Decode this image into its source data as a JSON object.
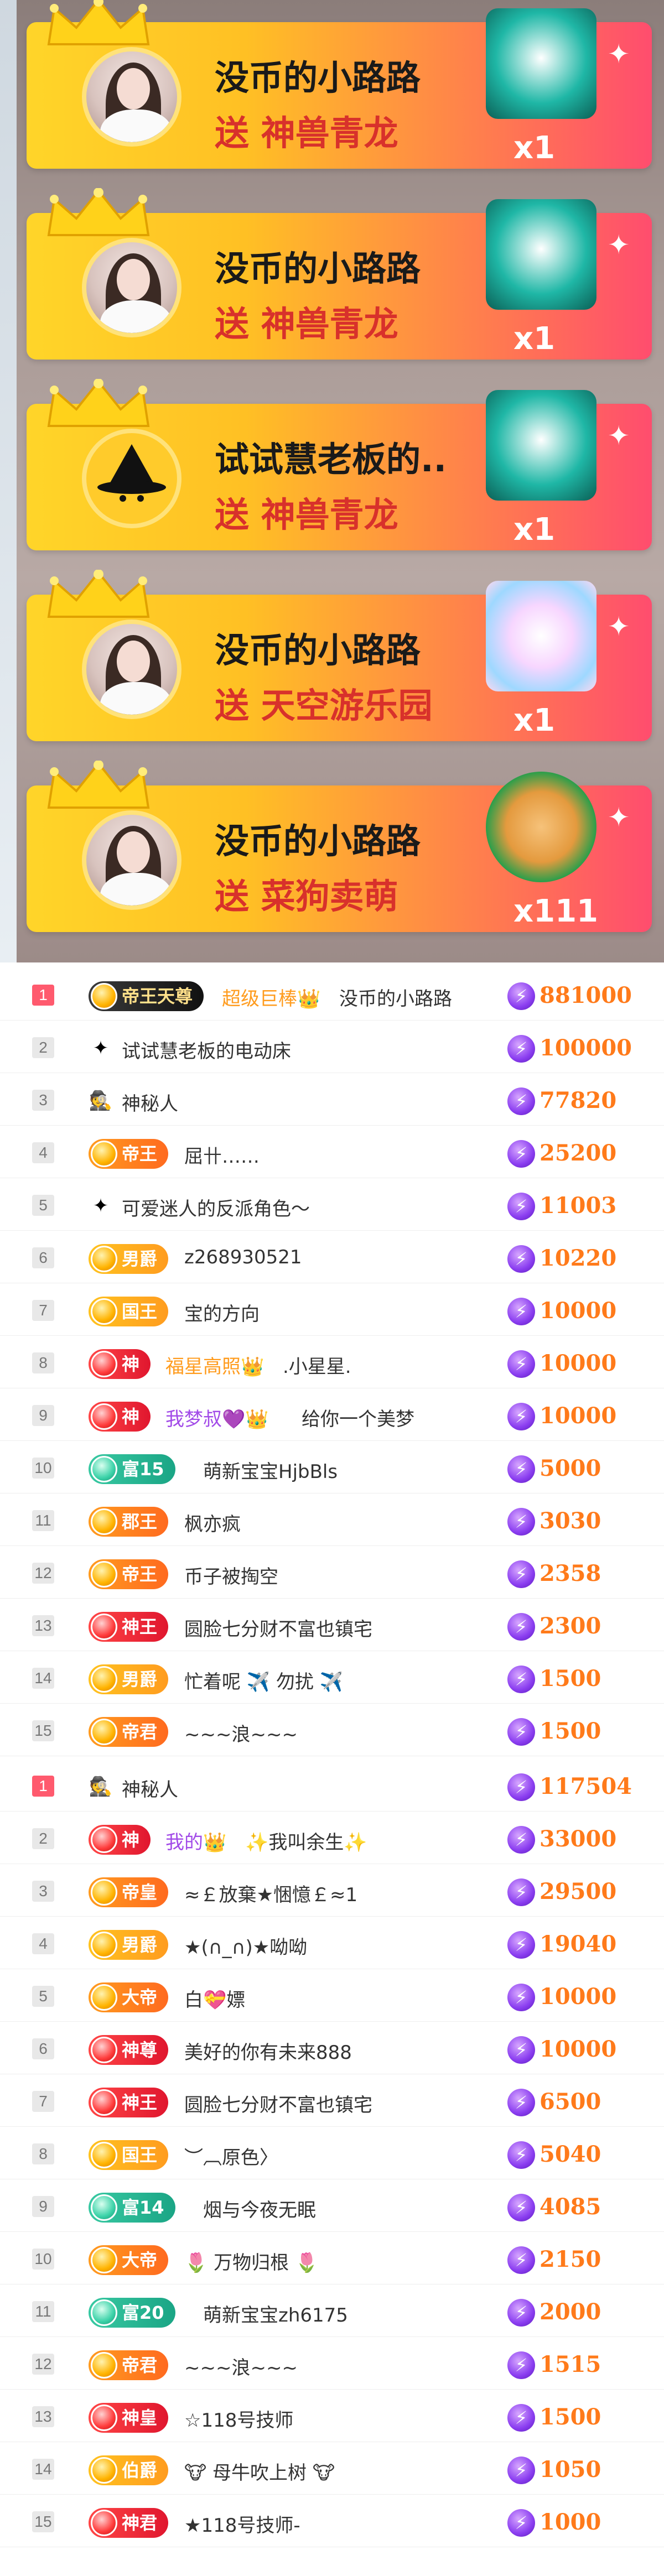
{
  "gift_banners": [
    {
      "name": "没币的小路路",
      "gift_text": "送 神兽青龙",
      "count": "x1",
      "avatar": "girl",
      "gift_icon": "dragon-icon",
      "gift_color": "#1fb7a6"
    },
    {
      "name": "没币的小路路",
      "gift_text": "送 神兽青龙",
      "count": "x1",
      "avatar": "girl",
      "gift_icon": "dragon-icon",
      "gift_color": "#1fb7a6"
    },
    {
      "name": "试试慧老板的..",
      "gift_text": "送 神兽青龙",
      "count": "x1",
      "avatar": "witch",
      "gift_icon": "dragon-icon",
      "gift_color": "#1fb7a6"
    },
    {
      "name": "没币的小路路",
      "gift_text": "送 天空游乐园",
      "count": "x1",
      "avatar": "girl",
      "gift_icon": "castle-icon",
      "gift_color": "#b9e3ff"
    },
    {
      "name": "没币的小路路",
      "gift_text": "送 菜狗卖萌",
      "count": "x111",
      "avatar": "girl",
      "gift_icon": "dog-icon",
      "gift_color": "#2e9e4a"
    }
  ],
  "ranking_1": [
    {
      "rank": "1",
      "badge": "帝王天尊",
      "badge_style": "dark",
      "prefix": "超级巨棒👑",
      "name": "没币的小路路",
      "name_style": "gold",
      "score": "881000"
    },
    {
      "rank": "2",
      "badge": "",
      "icon": "✦",
      "name": "试试慧老板的电动床",
      "score": "100000"
    },
    {
      "rank": "3",
      "badge": "",
      "icon": "🕵",
      "name": "神秘人",
      "score": "77820"
    },
    {
      "rank": "4",
      "badge": "帝王",
      "badge_style": "orange",
      "name": "屈卄……",
      "score": "25200"
    },
    {
      "rank": "5",
      "badge": "",
      "icon": "✦",
      "name": "可爱迷人的反派角色～",
      "score": "11003"
    },
    {
      "rank": "6",
      "badge": "男爵",
      "badge_style": "gold",
      "name": "z268930521",
      "score": "10220"
    },
    {
      "rank": "7",
      "badge": "国王",
      "badge_style": "gold",
      "name": "宝的方向",
      "score": "10000"
    },
    {
      "rank": "8",
      "badge": "神",
      "badge_style": "red",
      "prefix": "福星高照👑",
      "name": ".小星星.",
      "name_style": "gold",
      "score": "10000"
    },
    {
      "rank": "9",
      "badge": "神",
      "badge_style": "red",
      "prefix": "我梦叔💜👑",
      "name": "给你一个美梦",
      "name_style": "purple",
      "score": "10000"
    },
    {
      "rank": "10",
      "badge": "富15",
      "badge_style": "green",
      "name": "萌新宝宝HjbBls",
      "score": "5000"
    },
    {
      "rank": "11",
      "badge": "郡王",
      "badge_style": "orange",
      "name": "枫亦疯",
      "score": "3030"
    },
    {
      "rank": "12",
      "badge": "帝王",
      "badge_style": "orange",
      "name": "币子被掏空",
      "score": "2358"
    },
    {
      "rank": "13",
      "badge": "神王",
      "badge_style": "red",
      "name": "圆脸七分财不富也镇宅",
      "score": "2300"
    },
    {
      "rank": "14",
      "badge": "男爵",
      "badge_style": "gold",
      "name": "忙着呢 ✈️ 勿扰 ✈️",
      "score": "1500"
    },
    {
      "rank": "15",
      "badge": "帝君",
      "badge_style": "orange",
      "name": "~~~浪~~~",
      "score": "1500"
    }
  ],
  "ranking_2": [
    {
      "rank": "1",
      "badge": "",
      "icon": "🕵",
      "name": "神秘人",
      "score": "117504"
    },
    {
      "rank": "2",
      "badge": "神",
      "badge_style": "red",
      "prefix": "我的👑",
      "name": "✨我叫余生✨",
      "name_style": "purple",
      "score": "33000"
    },
    {
      "rank": "3",
      "badge": "帝皇",
      "badge_style": "orange",
      "name": "≈￡放棄★悃憶￡≈1",
      "score": "29500"
    },
    {
      "rank": "4",
      "badge": "男爵",
      "badge_style": "gold",
      "name": "★(∩_∩)★呦呦",
      "score": "19040"
    },
    {
      "rank": "5",
      "badge": "大帝",
      "badge_style": "orange",
      "name": "白💝嫖",
      "score": "10000"
    },
    {
      "rank": "6",
      "badge": "神尊",
      "badge_style": "red",
      "name": "美好的你有未来888",
      "score": "10000"
    },
    {
      "rank": "7",
      "badge": "神王",
      "badge_style": "red",
      "name": "圆脸七分财不富也镇宅",
      "score": "6500"
    },
    {
      "rank": "8",
      "badge": "国王",
      "badge_style": "gold",
      "name": "︶︹原色〉",
      "score": "5040"
    },
    {
      "rank": "9",
      "badge": "富14",
      "badge_style": "green",
      "name": "烟与今夜无眠",
      "score": "4085"
    },
    {
      "rank": "10",
      "badge": "大帝",
      "badge_style": "orange",
      "name": "🌷 万物归根 🌷",
      "score": "2150"
    },
    {
      "rank": "11",
      "badge": "富20",
      "badge_style": "green",
      "name": "萌新宝宝zh6175",
      "score": "2000"
    },
    {
      "rank": "12",
      "badge": "帝君",
      "badge_style": "orange",
      "name": "~~~浪~~~",
      "score": "1515"
    },
    {
      "rank": "13",
      "badge": "神皇",
      "badge_style": "red",
      "name": "☆118号技师",
      "score": "1500"
    },
    {
      "rank": "14",
      "badge": "伯爵",
      "badge_style": "gold",
      "name": "🐮 母牛吹上树 🐮",
      "score": "1050"
    },
    {
      "rank": "15",
      "badge": "神君",
      "badge_style": "red",
      "name": "★118号技师-",
      "score": "1000"
    }
  ],
  "score_icon": "⚡"
}
